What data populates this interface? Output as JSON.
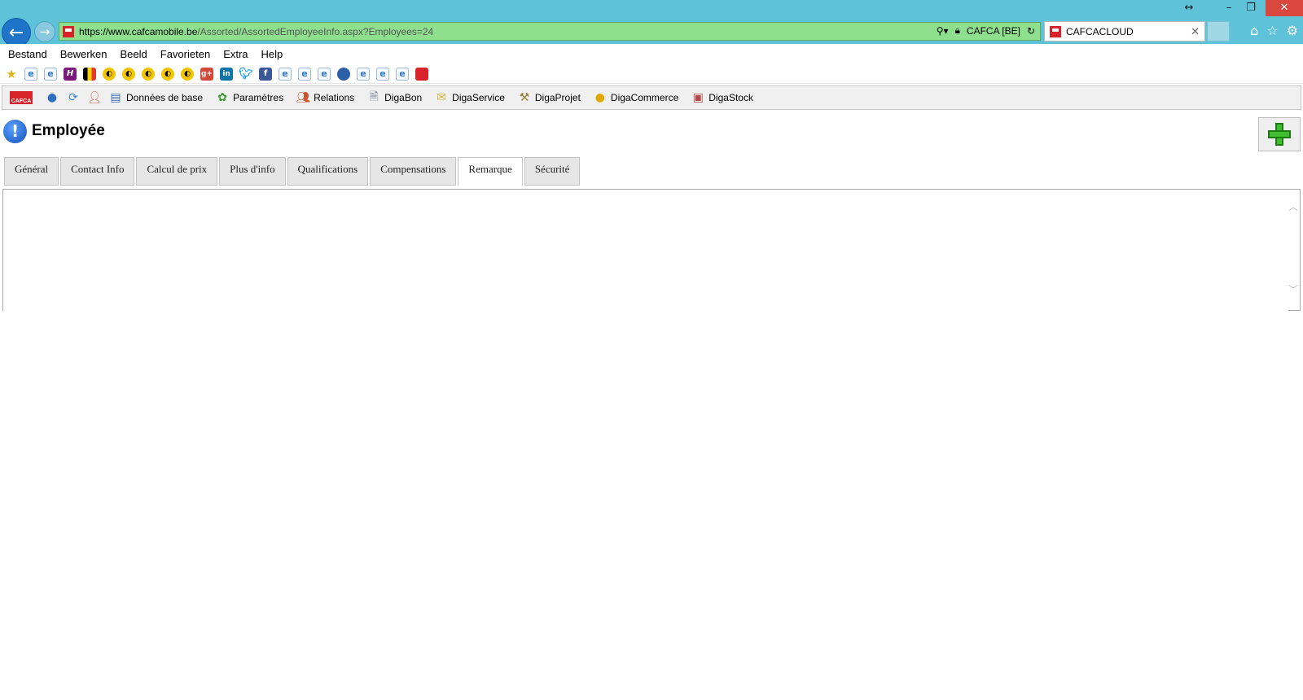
{
  "browser": {
    "url_scheme": "https://www.",
    "url_domain": "cafcamobile.be",
    "url_path": "/Assorted/AssortedEmployeeInfo.aspx?Employees=24",
    "site_identity": "CAFCA [BE]",
    "tab_title": "CAFCACLOUD",
    "icons": [
      "back-arrow-icon",
      "forward-arrow-icon",
      "search-icon",
      "lock-icon",
      "refresh-icon",
      "close-icon",
      "home-icon",
      "star-icon",
      "gear-icon"
    ]
  },
  "window": {
    "resize_glyph": "↔",
    "minimize_glyph": "–",
    "restore_glyph": "❐",
    "close_glyph": "✕"
  },
  "menu": {
    "items": [
      "Bestand",
      "Bewerken",
      "Beeld",
      "Favorieten",
      "Extra",
      "Help"
    ]
  },
  "favorites_bar": {
    "icons": [
      "add-favorite-star-icon",
      "ie-page-icon",
      "ie-page-icon",
      "h-site-icon",
      "belgium-flag-icon",
      "yellow-site-icon",
      "yellow-site-icon",
      "yellow-site-icon",
      "yellow-site-icon",
      "yellow-site-icon",
      "google-plus-icon",
      "linkedin-icon",
      "twitter-icon",
      "facebook-icon",
      "ie-page-icon",
      "ie-page-icon",
      "ie-page-icon",
      "globe-icon",
      "ie-page-icon",
      "ie-page-icon",
      "ie-page-icon",
      "cafca-icon"
    ]
  },
  "toolbar": {
    "logo_text": "CAFCA",
    "items": [
      {
        "label": "Données de base"
      },
      {
        "label": "Paramètres"
      },
      {
        "label": "Relations"
      },
      {
        "label": "DigaBon"
      },
      {
        "label": "DigaService"
      },
      {
        "label": "DigaProjet"
      },
      {
        "label": "DigaCommerce"
      },
      {
        "label": "DigaStock"
      }
    ]
  },
  "page": {
    "title": "Employée",
    "tabs": [
      {
        "label": "Général"
      },
      {
        "label": "Contact Info"
      },
      {
        "label": "Calcul de prix"
      },
      {
        "label": "Plus d'info"
      },
      {
        "label": "Qualifications"
      },
      {
        "label": "Compensations"
      },
      {
        "label": "Remarque"
      },
      {
        "label": "Sécurité"
      }
    ],
    "active_tab": "Remarque",
    "remark_value": ""
  }
}
